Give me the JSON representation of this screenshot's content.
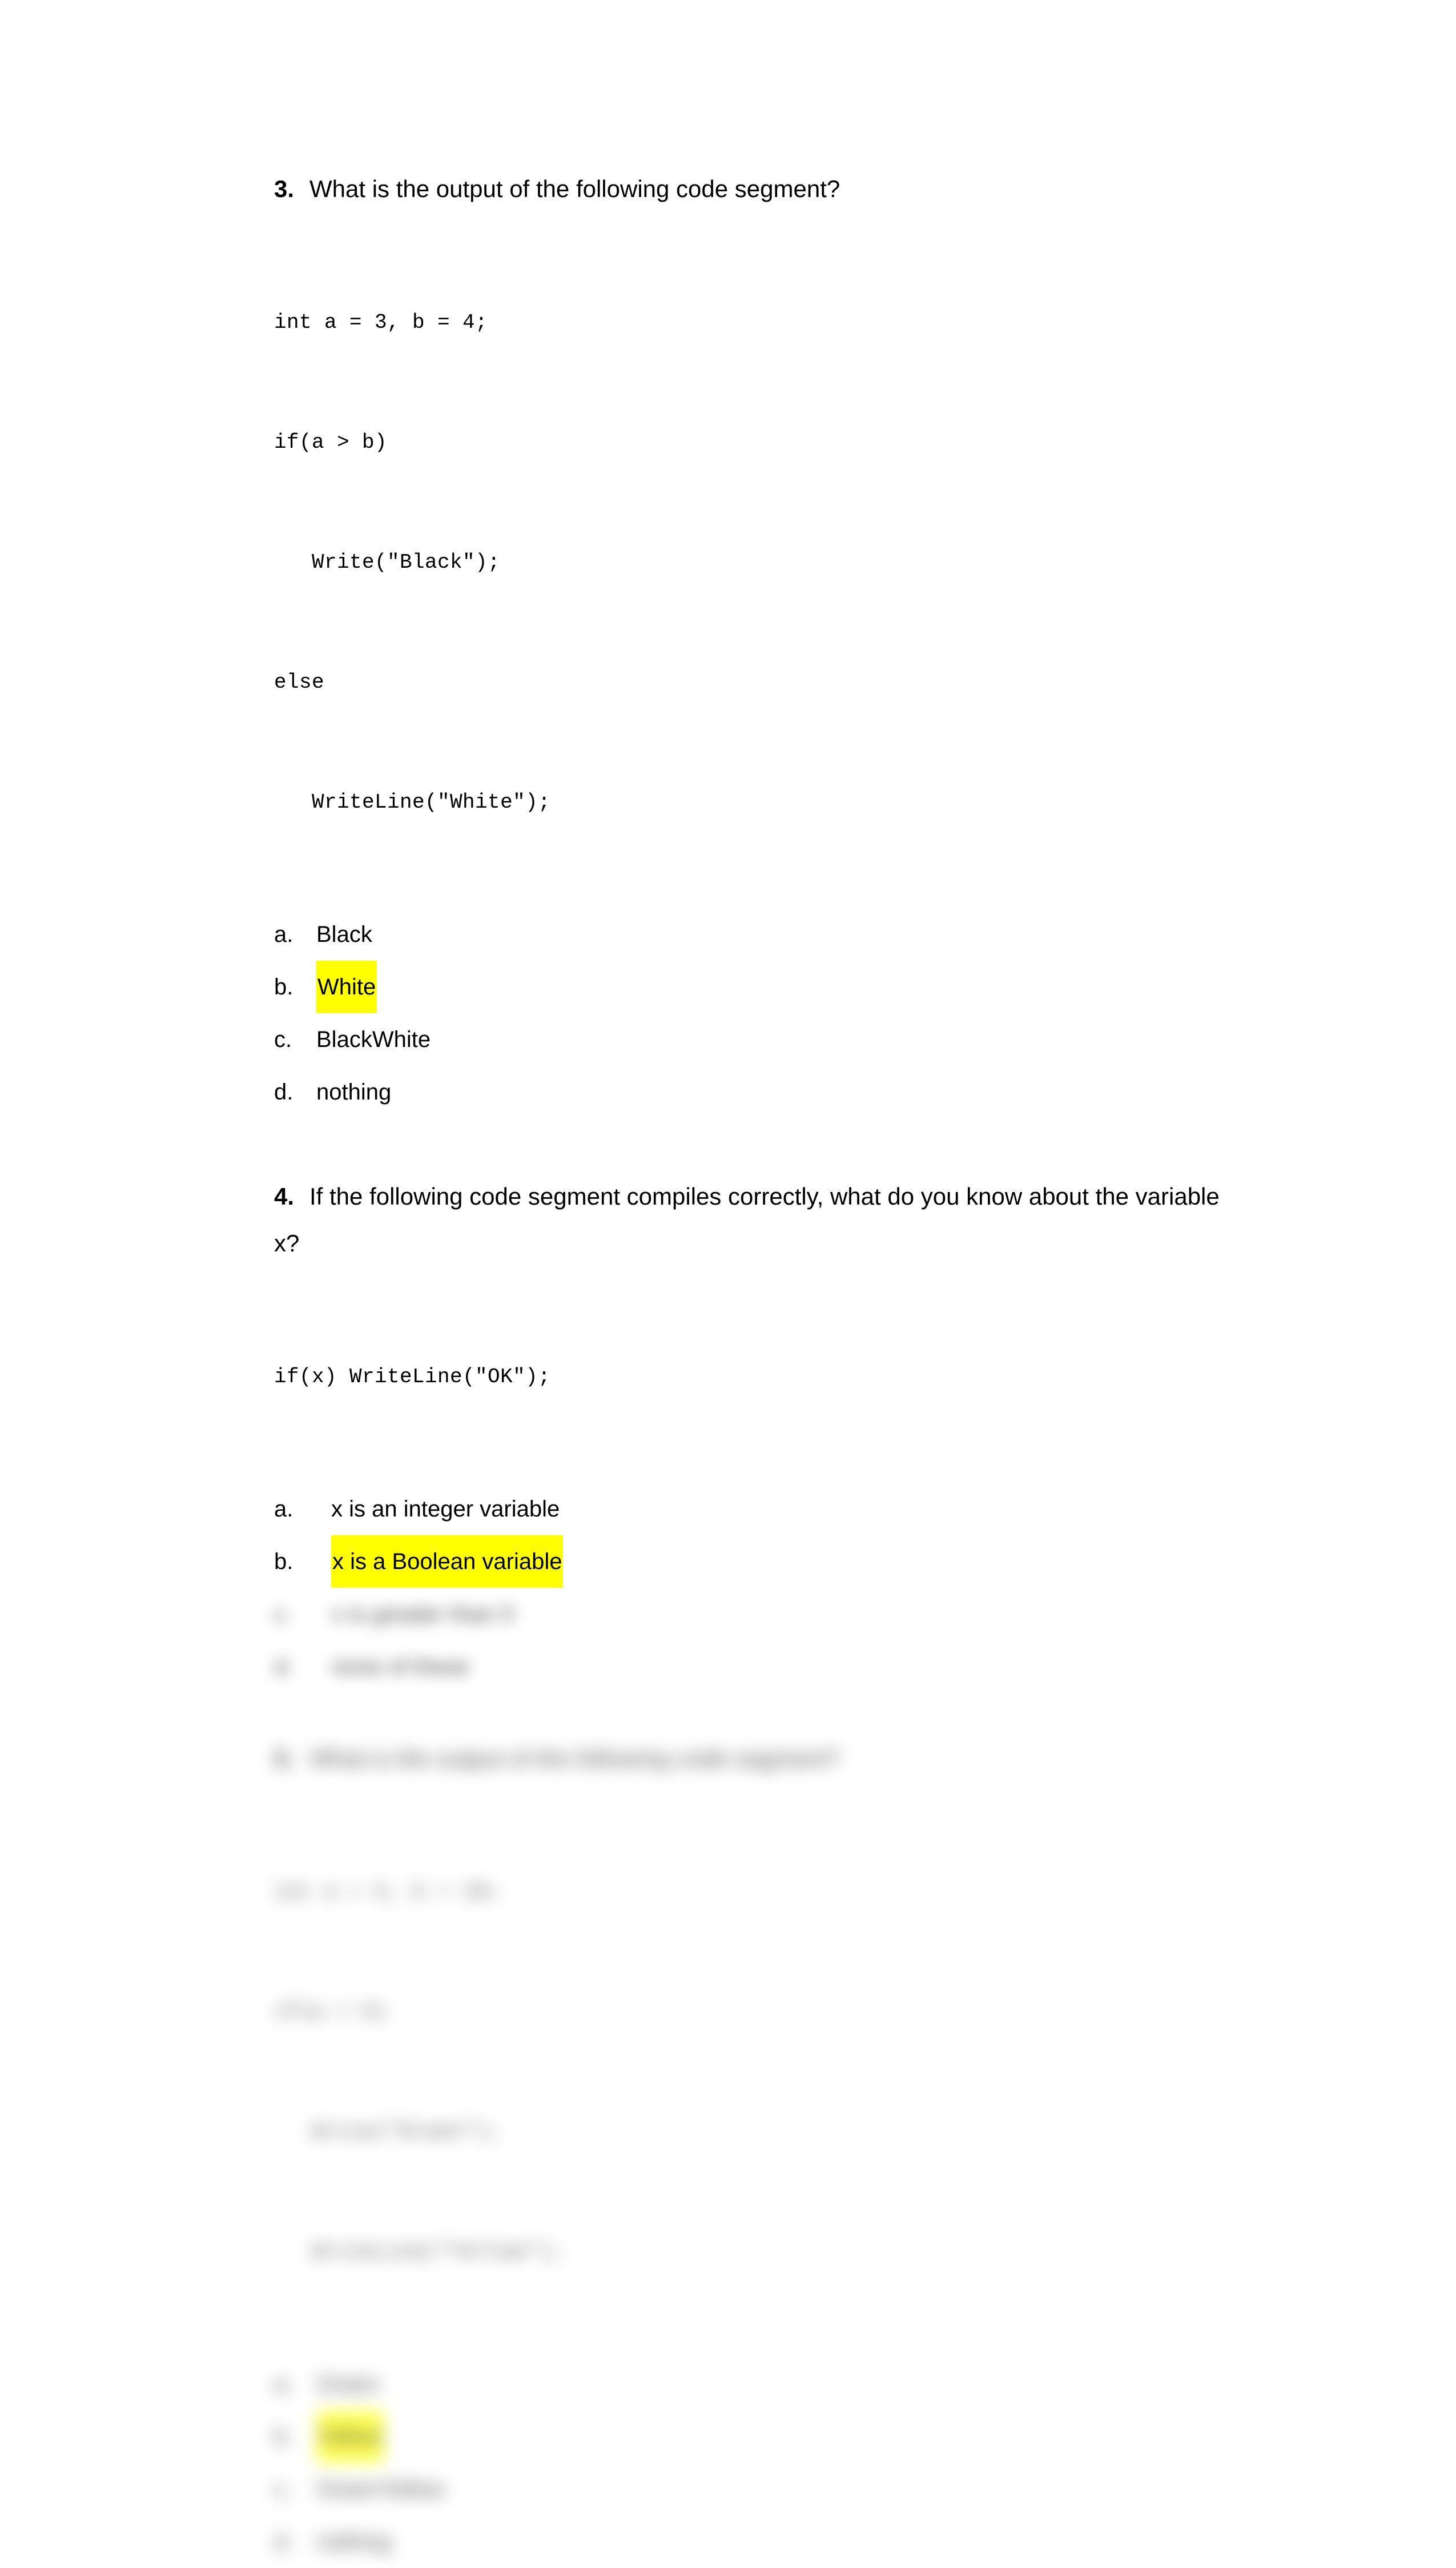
{
  "document": {
    "background_color": "#ffffff",
    "text_color": "#000000",
    "highlight_color": "#ffff00"
  },
  "questions": [
    {
      "number": "3.",
      "text": "What is the output of the following code segment?",
      "code": [
        "int a = 3, b = 4;",
        "if(a > b)",
        "   Write(\"Black\");",
        "else",
        "   WriteLine(\"White\");"
      ],
      "options": [
        {
          "marker": "a.",
          "text": "Black",
          "highlighted": false
        },
        {
          "marker": "b.",
          "text": "White",
          "highlighted": true
        },
        {
          "marker": "c.",
          "text": "BlackWhite",
          "highlighted": false
        },
        {
          "marker": "d.",
          "text": "nothing",
          "highlighted": false
        }
      ],
      "blurred": false
    },
    {
      "number": "4.",
      "text": "If the following code segment compiles correctly, what do you know about the variable x?",
      "code": [
        "if(x) WriteLine(\"OK\");"
      ],
      "options": [
        {
          "marker": "a.",
          "text": "x is an integer variable",
          "highlighted": false,
          "blurred": false
        },
        {
          "marker": "b.",
          "text": "x is a Boolean variable",
          "highlighted": true,
          "blurred": false
        },
        {
          "marker": "c.",
          "text": "x is greater than 0",
          "highlighted": false,
          "blurred": true
        },
        {
          "marker": "d.",
          "text": "none of these",
          "highlighted": false,
          "blurred": true
        }
      ],
      "blurred": false
    },
    {
      "number": "5.",
      "text": "What is the output of the following code segment?",
      "code": [
        "int a = 5, b = 10;",
        "if(a > b)",
        "   Write(\"Green\");",
        "   WriteLine(\"Yellow\");"
      ],
      "options": [
        {
          "marker": "a.",
          "text": "Green",
          "highlighted": false
        },
        {
          "marker": "b.",
          "text": "Yellow",
          "highlighted": true
        },
        {
          "marker": "c.",
          "text": "GreenYellow",
          "highlighted": false
        },
        {
          "marker": "d.",
          "text": "nothing",
          "highlighted": false
        }
      ],
      "blurred": true
    }
  ]
}
